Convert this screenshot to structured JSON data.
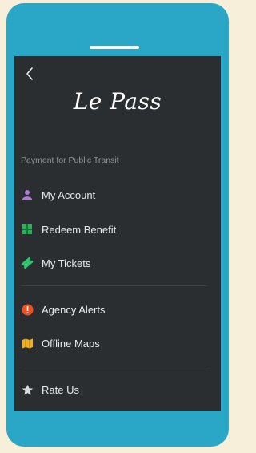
{
  "app": {
    "logo_text": "Le Pass",
    "subtitle": "Payment for Public Transit"
  },
  "menu": {
    "group1": [
      {
        "label": "My Account",
        "icon": "person-icon",
        "color": "#b07ad6"
      },
      {
        "label": "Redeem Benefit",
        "icon": "gift-icon",
        "color": "#27b35a"
      },
      {
        "label": "My Tickets",
        "icon": "ticket-icon",
        "color": "#2ec36c"
      }
    ],
    "group2": [
      {
        "label": "Agency Alerts",
        "icon": "alert-icon",
        "color": "#f04e23"
      },
      {
        "label": "Offline Maps",
        "icon": "map-icon",
        "color": "#f2b01e"
      }
    ],
    "group3": [
      {
        "label": "Rate Us",
        "icon": "star-icon",
        "color": "#d8dbde"
      }
    ]
  },
  "colors": {
    "page_bg": "#f7efd9",
    "phone_frame": "#2aa7c6",
    "screen_bg": "#2b2e30"
  }
}
